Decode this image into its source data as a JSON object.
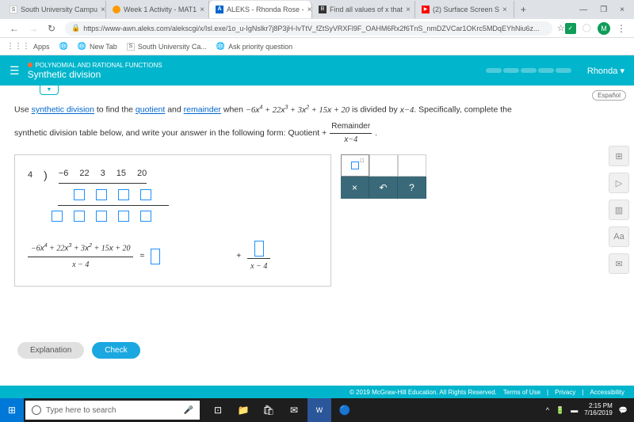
{
  "browser": {
    "tabs": [
      {
        "label": "South University Campu",
        "favicon": "S"
      },
      {
        "label": "Week 1 Activity - MAT1",
        "favicon": "B"
      },
      {
        "label": "ALEKS - Rhonda Rose -",
        "favicon": "A",
        "active": true
      },
      {
        "label": "Find all values of x that",
        "favicon": "B"
      },
      {
        "label": "(2) Surface Screen S",
        "favicon": "▶"
      }
    ],
    "url": "https://www-awn.aleks.com/alekscgi/x/Isl.exe/1o_u-IgNslkr7j8P3jH-IvTtV_fZtSyVRXFl9F_OAHM6Rx2f6TnS_nmDZVCar1OKrc5MDqEYhNiu6z...",
    "bookmarks": {
      "apps": "Apps",
      "items": [
        "New Tab",
        "South University Ca...",
        "Ask priority question"
      ]
    },
    "avatar": "M"
  },
  "header": {
    "category": "POLYNOMIAL AND RATIONAL FUNCTIONS",
    "title": "Synthetic division",
    "user": "Rhonda"
  },
  "espanol": "Español",
  "problem": {
    "text1": "Use ",
    "link1": "synthetic division",
    "text2": " to find the ",
    "link2": "quotient",
    "text3": " and ",
    "link3": "remainder",
    "text4": " when ",
    "poly": "−6x⁴ + 22x³ + 3x² + 15x + 20",
    "text5": " is divided by ",
    "divisor": "x−4",
    "text6": ". Specifically, complete the synthetic division table below, and write your answer in the following form: Quotient + ",
    "remainder_label": "Remainder",
    "period": "."
  },
  "synthetic": {
    "divisor": "4",
    "row1": [
      "−6",
      "22",
      "3",
      "15",
      "20"
    ],
    "expr_num": "−6x⁴ + 22x³ + 3x² + 15x + 20",
    "expr_den": "x − 4",
    "equals": "=",
    "plus": "+",
    "right_den": "x − 4"
  },
  "buttons": {
    "explanation": "Explanation",
    "check": "Check"
  },
  "tools": {
    "close": "×",
    "undo": "↶",
    "help": "?"
  },
  "footer": {
    "copyright": "© 2019 McGraw-Hill Education. All Rights Reserved.",
    "terms": "Terms of Use",
    "privacy": "Privacy",
    "accessibility": "Accessibility"
  },
  "taskbar": {
    "search": "Type here to search",
    "time": "2:15 PM",
    "date": "7/16/2019"
  }
}
